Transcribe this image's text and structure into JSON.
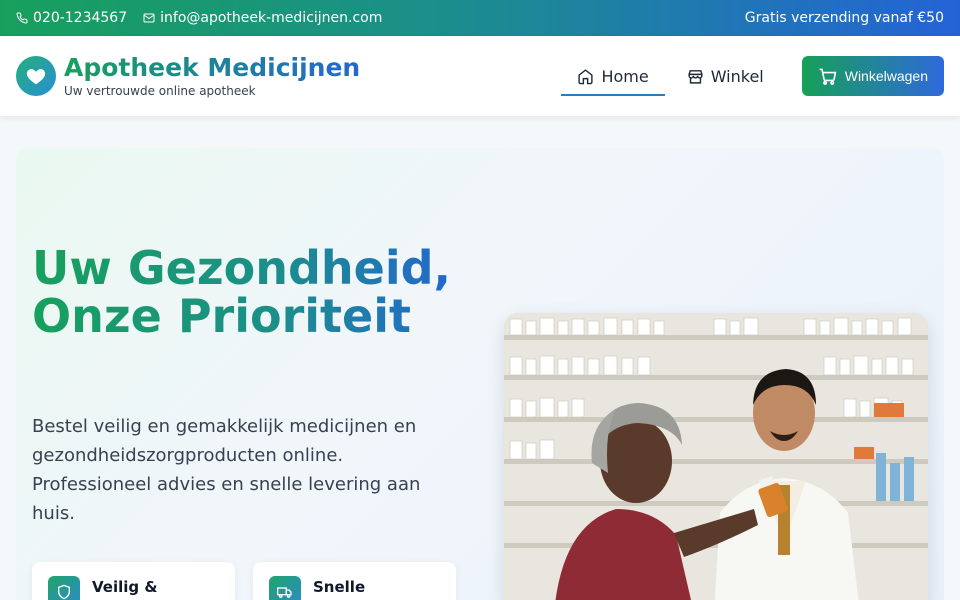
{
  "topbar": {
    "phone": "020-1234567",
    "email": "info@apotheek-medicijnen.com",
    "promo": "Gratis verzending vanaf €50"
  },
  "brand": {
    "title": "Apotheek Medicijnen",
    "subtitle": "Uw vertrouwde online apotheek",
    "logo_icon": "heart-icon"
  },
  "nav": {
    "items": [
      {
        "label": "Home",
        "icon": "home-icon",
        "active": true
      },
      {
        "label": "Winkel",
        "icon": "store-icon",
        "active": false
      }
    ],
    "cart_label": "Winkelwagen"
  },
  "hero": {
    "headline": "Uw Gezondheid, Onze Prioriteit",
    "lead": "Bestel veilig en gemakkelijk medicijnen en gezondheidszorgproducten online. Professioneel advies en snelle levering aan huis.",
    "features": [
      {
        "title": "Veilig &",
        "icon": "shield-icon"
      },
      {
        "title": "Snelle",
        "icon": "truck-icon"
      }
    ]
  },
  "colors": {
    "green": "#17a05d",
    "blue": "#2463d6",
    "text": "#1f2937"
  }
}
